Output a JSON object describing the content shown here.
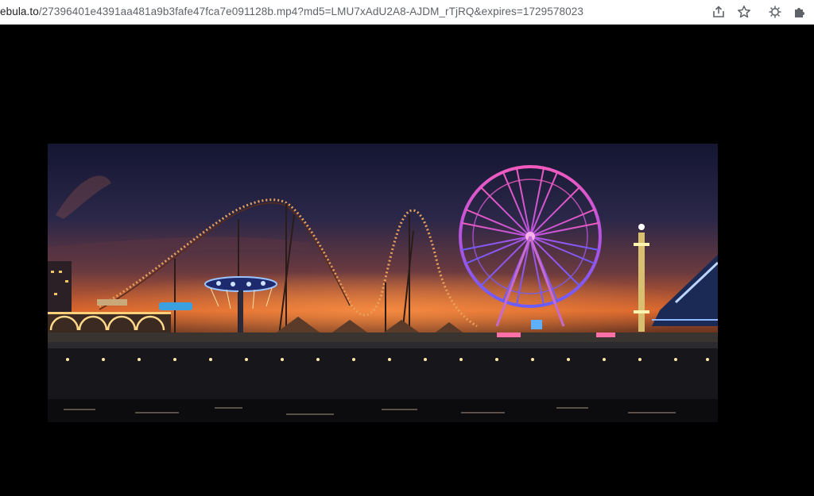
{
  "browser": {
    "url_host": "ebula.to",
    "url_path": "/27396401e4391aa481a9b3fafe47fca7e091128b.mp4?md5=LMU7xAdU2A8-AJDM_rTjRQ&expires=1729578023",
    "icons": [
      "share-icon",
      "star-icon",
      "extension-icon",
      "puzzle-icon"
    ]
  },
  "video": {
    "scene": "amusement-pier-night",
    "colors": {
      "ferris_top": "#e84ab0",
      "ferris_bottom": "#6a5cff",
      "sky_top": "#141632",
      "horizon": "#d9632a"
    }
  }
}
